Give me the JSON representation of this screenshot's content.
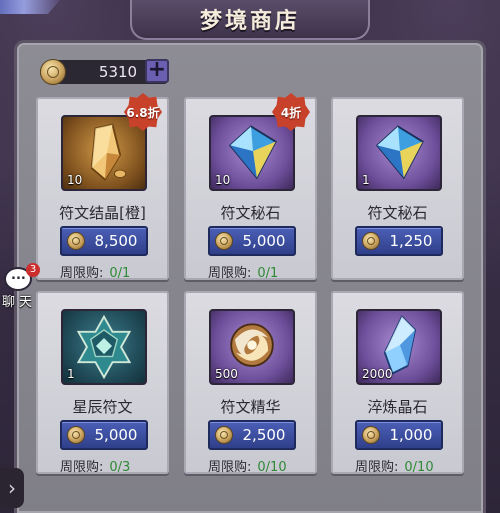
{
  "window": {
    "title": "梦境商店"
  },
  "currency": {
    "amount": "5310",
    "add_label": "+"
  },
  "chat": {
    "label": "聊天",
    "badge": "3"
  },
  "nav": {
    "arrow": "›"
  },
  "items": [
    {
      "name": "符文结晶[橙]",
      "qty": "10",
      "price": "8,500",
      "discount": "6.8折",
      "limit_label": "周限购:",
      "limit_count": "0/1",
      "icon": "orange-crystal-icon"
    },
    {
      "name": "符文秘石",
      "qty": "10",
      "price": "5,000",
      "discount": "4折",
      "limit_label": "周限购:",
      "limit_count": "0/1",
      "icon": "rune-stone-icon"
    },
    {
      "name": "符文秘石",
      "qty": "1",
      "price": "1,250",
      "discount": "",
      "limit_label": "",
      "limit_count": "",
      "icon": "rune-stone-icon"
    },
    {
      "name": "星辰符文",
      "qty": "1",
      "price": "5,000",
      "discount": "",
      "limit_label": "周限购:",
      "limit_count": "0/3",
      "icon": "star-rune-icon"
    },
    {
      "name": "符文精华",
      "qty": "500",
      "price": "2,500",
      "discount": "",
      "limit_label": "周限购:",
      "limit_count": "0/10",
      "icon": "rune-essence-icon"
    },
    {
      "name": "淬炼晶石",
      "qty": "2000",
      "price": "1,000",
      "discount": "",
      "limit_label": "周限购:",
      "limit_count": "0/10",
      "icon": "blue-crystal-icon"
    }
  ],
  "colors": {
    "price_button": "#3a4ea3",
    "discount_badge": "#c7412b",
    "limit_count": "#2f8a35",
    "panel": "#8d8c94"
  }
}
